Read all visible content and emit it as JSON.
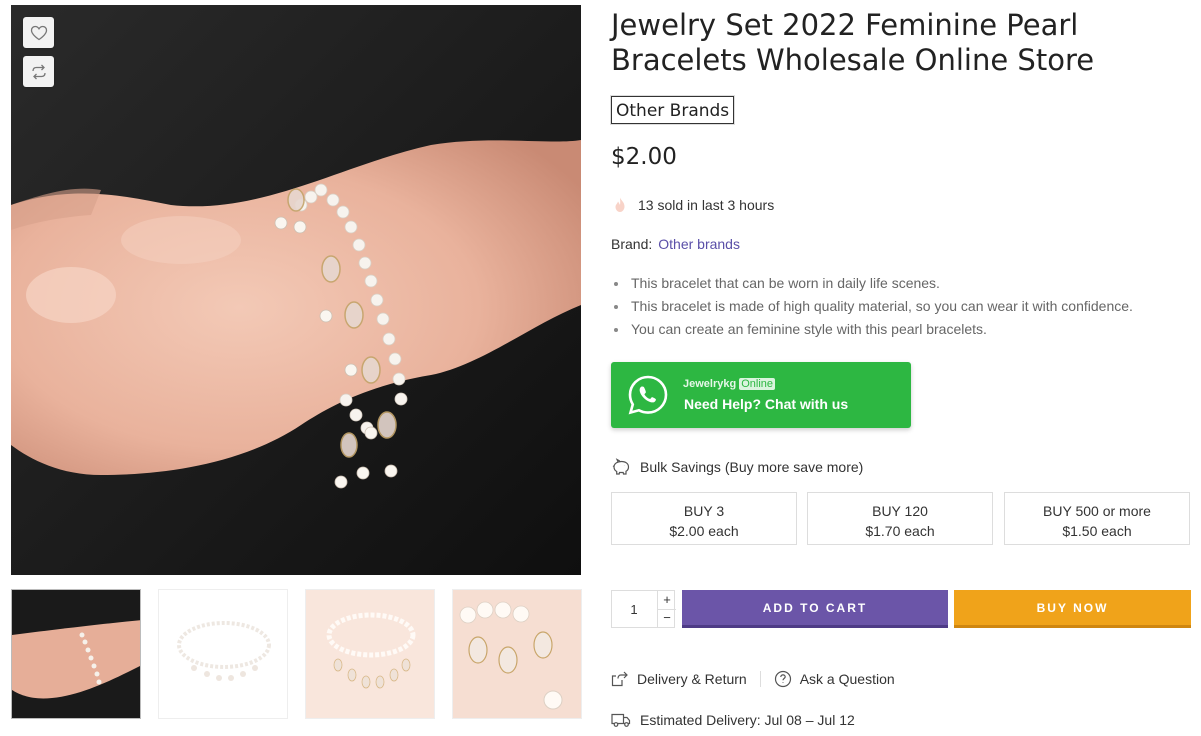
{
  "product": {
    "title": "Jewelry Set 2022 Feminine Pearl Bracelets Wholesale Online Store",
    "brand_tag": "Other Brands",
    "price": "$2.00",
    "sold_text": "13 sold in last 3 hours",
    "brand_label": "Brand:",
    "brand_value": "Other brands",
    "features": [
      "This bracelet that can be worn in daily life scenes.",
      "This bracelet is made of high quality material, so you can wear it with confidence.",
      "You can create an feminine style with this pearl bracelets."
    ]
  },
  "gallery": {
    "wishlist_icon": "heart-icon",
    "compare_icon": "compare-icon",
    "thumbnail_count": 4
  },
  "whatsapp": {
    "name": "Jewelrykg",
    "status": "Online",
    "cta": "Need Help? Chat with us",
    "color": "#2db742"
  },
  "bulk": {
    "heading": "Bulk Savings (Buy more save more)",
    "tiers": [
      {
        "qty": "BUY 3",
        "price": "$2.00 each"
      },
      {
        "qty": "BUY 120",
        "price": "$1.70 each"
      },
      {
        "qty": "BUY 500 or more",
        "price": "$1.50 each"
      }
    ]
  },
  "purchase": {
    "quantity": "1",
    "plus": "+",
    "minus": "−",
    "add_to_cart": "ADD TO CART",
    "buy_now": "BUY NOW",
    "cart_color": "#6b55a8",
    "buy_color": "#f0a31a"
  },
  "links": {
    "delivery_return": "Delivery & Return",
    "ask_question": "Ask a Question"
  },
  "delivery": {
    "estimated": "Estimated Delivery: Jul 08 – Jul 12"
  }
}
